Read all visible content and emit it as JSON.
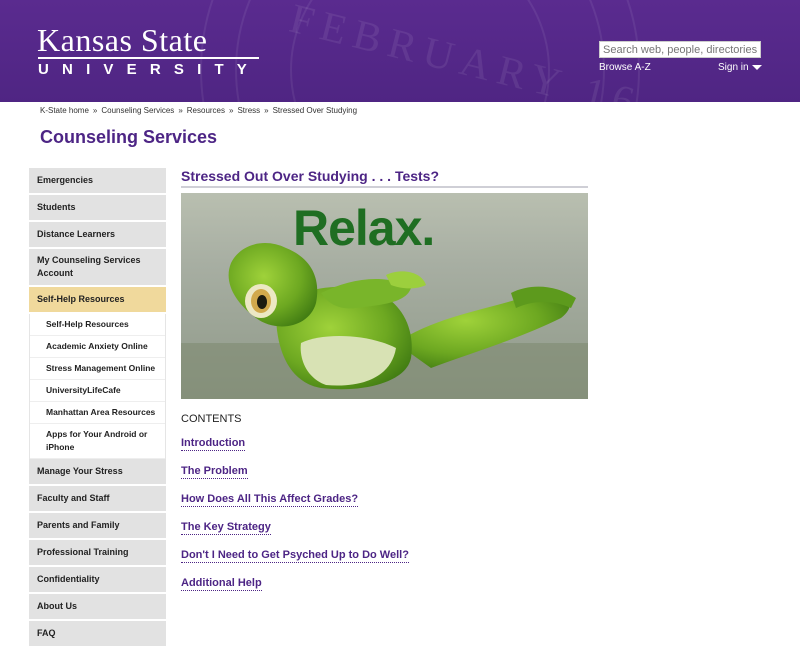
{
  "header": {
    "logo_line1": "Kansas State",
    "logo_line2": "UNIVERSITY",
    "seal_text": "FEBRUARY 16,",
    "search_placeholder": "Search web, people, directories",
    "browse_label": "Browse A-Z",
    "signin_label": "Sign in"
  },
  "breadcrumb": [
    "K-State home",
    "Counseling Services",
    "Resources",
    "Stress",
    "Stressed Over Studying"
  ],
  "site_title": "Counseling Services",
  "sidebar": {
    "items": [
      {
        "label": "Emergencies"
      },
      {
        "label": "Students"
      },
      {
        "label": "Distance Learners"
      },
      {
        "label": "My Counseling Services Account"
      },
      {
        "label": "Self-Help Resources"
      }
    ],
    "subitems": [
      {
        "label": "Self-Help Resources"
      },
      {
        "label": "Academic Anxiety Online"
      },
      {
        "label": "Stress Management Online"
      },
      {
        "label": "UniversityLifeCafe"
      },
      {
        "label": "Manhattan Area Resources"
      },
      {
        "label": "Apps for Your Android or iPhone"
      }
    ],
    "items_after": [
      {
        "label": "Manage Your Stress"
      },
      {
        "label": "Faculty and Staff"
      },
      {
        "label": "Parents and Family"
      },
      {
        "label": "Professional Training"
      },
      {
        "label": "Confidentiality"
      },
      {
        "label": "About Us"
      },
      {
        "label": "FAQ"
      }
    ]
  },
  "main": {
    "title": "Stressed Out Over Studying . . . Tests?",
    "hero_text": "Relax.",
    "contents_label": "CONTENTS",
    "toc": [
      {
        "label": "Introduction"
      },
      {
        "label": "The Problem"
      },
      {
        "label": "How Does All This Affect Grades?"
      },
      {
        "label": "The Key Strategy"
      },
      {
        "label": "Don't I Need to Get Psyched Up to Do Well?"
      },
      {
        "label": "Additional Help"
      }
    ]
  },
  "colors": {
    "brand_purple": "#512888",
    "active_nav": "#f0d99c",
    "nav_bg": "#e2e2e2"
  }
}
